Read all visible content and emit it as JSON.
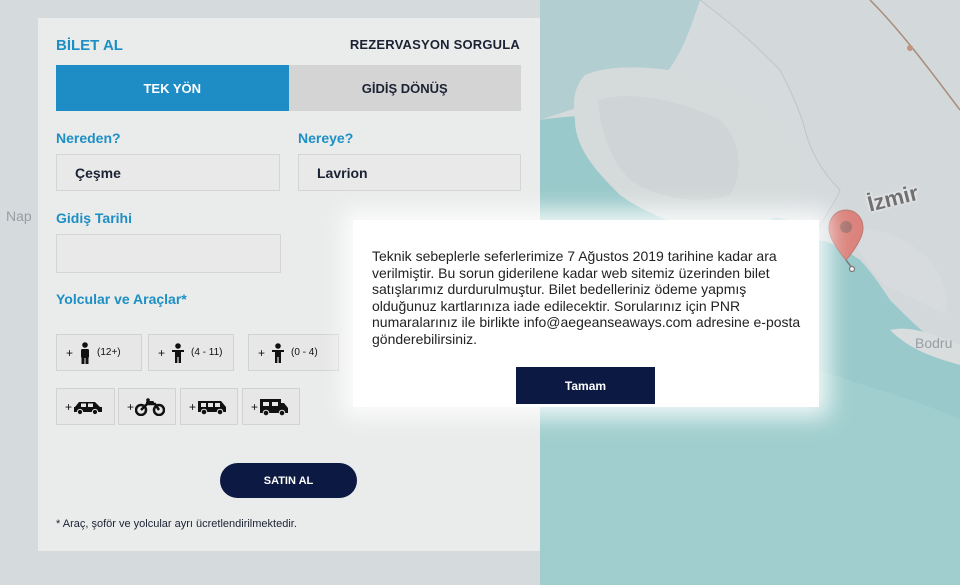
{
  "map": {
    "city_label": "İzmir",
    "partial_labels": [
      "Nap",
      "Bodru"
    ]
  },
  "booking": {
    "title": "BİLET AL",
    "reservation_link": "REZERVASYON SORGULA",
    "tabs": [
      {
        "label": "TEK YÖN",
        "active": true
      },
      {
        "label": "GİDİŞ DÖNÜŞ",
        "active": false
      }
    ],
    "from": {
      "label": "Nereden?",
      "value": "Çeşme"
    },
    "to": {
      "label": "Nereye?",
      "value": "Lavrion"
    },
    "date": {
      "label": "Gidiş Tarihi",
      "value": ""
    },
    "passengers_label": "Yolcular ve Araçlar*",
    "passengers": [
      {
        "plus": "+",
        "age": "(12+)",
        "icon": "adult-icon"
      },
      {
        "plus": "+",
        "age": "(4 - 11)",
        "icon": "child-icon"
      },
      {
        "plus": "+",
        "age": "(0 - 4)",
        "icon": "infant-icon"
      }
    ],
    "vehicles": [
      {
        "plus": "+",
        "icon": "car-icon"
      },
      {
        "plus": "+",
        "icon": "motorcycle-icon"
      },
      {
        "plus": "+",
        "icon": "minibus-icon"
      },
      {
        "plus": "+",
        "icon": "caravan-icon"
      }
    ],
    "buy_button": "SATIN AL",
    "footnote": "* Araç, şoför ve yolcular ayrı ücretlendirilmektedir."
  },
  "modal": {
    "message": "Teknik sebeplerle seferlerimize 7 Ağustos 2019 tarihine kadar ara verilmiştir. Bu sorun giderilene kadar web sitemiz üzerinden bilet satışlarımız durdurulmuştur. Bilet bedelleriniz ödeme yapmış olduğunuz kartlarınıza iade edilecektir. Sorularınız için PNR numaralarınız ile birlikte info@aegeanseaways.com adresine e-posta gönderebilirsiniz.",
    "ok_button": "Tamam"
  },
  "colors": {
    "accent": "#1f8dc5",
    "navy": "#0c1a43",
    "sea": "#5fb7b9",
    "land": "#c9d3d8"
  }
}
